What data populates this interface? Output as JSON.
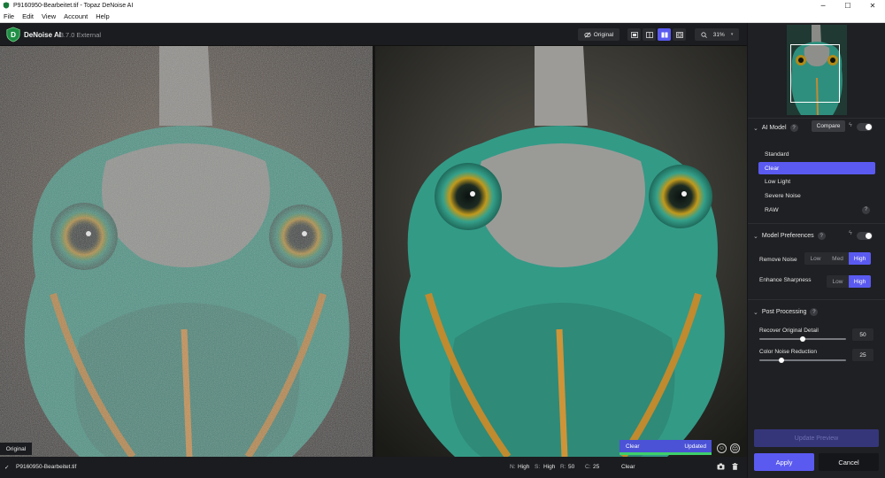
{
  "window": {
    "title": "P9160950-Bearbeitet.tif - Topaz DeNoise AI",
    "controls": {
      "minimize": "─",
      "maximize": "☐",
      "close": "✕"
    }
  },
  "menu": [
    "File",
    "Edit",
    "View",
    "Account",
    "Help"
  ],
  "app": {
    "name": "DeNoise AI",
    "version": "v3.7.0 External"
  },
  "toolbar": {
    "original_label": "Original",
    "zoom": "31%",
    "active_view": "side-by-side"
  },
  "preview": {
    "left_label": "Original",
    "right_model": "Clear",
    "right_status": "Updated",
    "progress": 1.0
  },
  "status": {
    "filename": "P9160950-Bearbeitet.tif",
    "noise_label": "N:",
    "noise_value": "High",
    "sharp_label": "S:",
    "sharp_value": "High",
    "recover_label": "R:",
    "recover_value": "50",
    "color_label": "C:",
    "color_value": "25",
    "model": "Clear"
  },
  "sidebar": {
    "ai_model": {
      "title": "AI Model",
      "compare_label": "Compare",
      "models": [
        "Standard",
        "Clear",
        "Low Light",
        "Severe Noise",
        "RAW"
      ],
      "selected": "Clear"
    },
    "model_preferences": {
      "title": "Model Preferences",
      "remove_noise_label": "Remove Noise",
      "remove_noise_options": [
        "Low",
        "Med",
        "High"
      ],
      "remove_noise_selected": "High",
      "enhance_sharpness_label": "Enhance Sharpness",
      "enhance_sharpness_options": [
        "Low",
        "High"
      ],
      "enhance_sharpness_selected": "High"
    },
    "post_processing": {
      "title": "Post Processing",
      "recover_label": "Recover Original Detail",
      "recover_value": "50",
      "color_noise_label": "Color Noise Reduction",
      "color_noise_value": "25"
    },
    "update_preview_label": "Update Preview",
    "apply_label": "Apply",
    "cancel_label": "Cancel"
  },
  "colors": {
    "accent": "#5a5af0",
    "panel": "#1f2023",
    "success": "#3ecf6b"
  }
}
